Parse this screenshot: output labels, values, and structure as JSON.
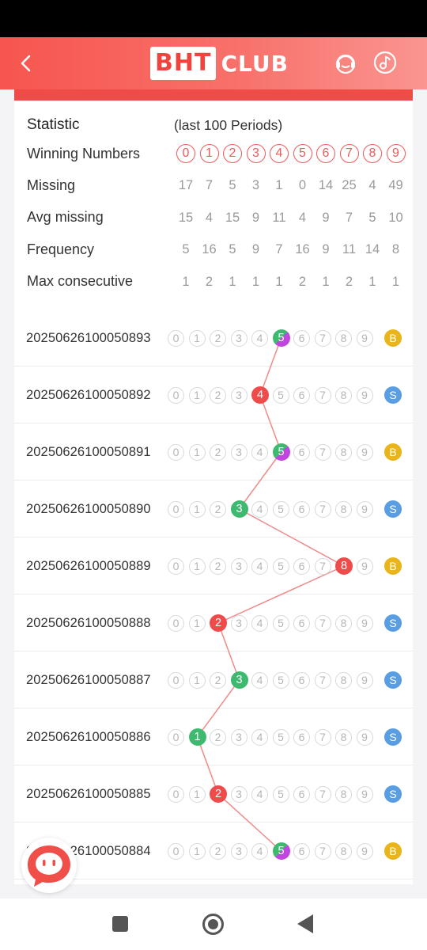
{
  "header": {
    "logo_box": "BHT",
    "logo_text": "CLUB",
    "icons": {
      "back": "back-arrow-icon",
      "support": "customer-service-icon",
      "music": "music-note-icon"
    }
  },
  "stats": {
    "title_label": "Statistic",
    "period_label": "(last 100 Periods)",
    "winning_numbers_label": "Winning Numbers",
    "winning_numbers": [
      "0",
      "1",
      "2",
      "3",
      "4",
      "5",
      "6",
      "7",
      "8",
      "9"
    ],
    "rows": [
      {
        "label": "Missing",
        "values": [
          "17",
          "7",
          "5",
          "3",
          "1",
          "0",
          "14",
          "25",
          "4",
          "49"
        ]
      },
      {
        "label": "Avg missing",
        "values": [
          "15",
          "4",
          "15",
          "9",
          "11",
          "4",
          "9",
          "7",
          "5",
          "10"
        ]
      },
      {
        "label": "Frequency",
        "values": [
          "5",
          "16",
          "5",
          "9",
          "7",
          "16",
          "9",
          "11",
          "14",
          "8"
        ]
      },
      {
        "label": "Max consecutive",
        "values": [
          "1",
          "2",
          "1",
          "1",
          "1",
          "2",
          "1",
          "2",
          "1",
          "1"
        ]
      }
    ]
  },
  "digits": [
    "0",
    "1",
    "2",
    "3",
    "4",
    "5",
    "6",
    "7",
    "8",
    "9"
  ],
  "history": [
    {
      "issue": "20250626100050893",
      "number": 5,
      "size": "B"
    },
    {
      "issue": "20250626100050892",
      "number": 4,
      "size": "S"
    },
    {
      "issue": "20250626100050891",
      "number": 5,
      "size": "B"
    },
    {
      "issue": "20250626100050890",
      "number": 3,
      "size": "S"
    },
    {
      "issue": "20250626100050889",
      "number": 8,
      "size": "B"
    },
    {
      "issue": "20250626100050888",
      "number": 2,
      "size": "S"
    },
    {
      "issue": "20250626100050887",
      "number": 3,
      "size": "S"
    },
    {
      "issue": "20250626100050886",
      "number": 1,
      "size": "S"
    },
    {
      "issue": "20250626100050885",
      "number": 2,
      "size": "S"
    },
    {
      "issue": "20250626100050884",
      "number": 5,
      "size": "B"
    }
  ],
  "colors": {
    "header_start": "#f7554f",
    "header_end": "#fa9590",
    "red": "#ef4b4b",
    "green": "#3dba6f",
    "violet": "#c345e0",
    "big": "#eab51a",
    "small": "#5a9de3",
    "trend_line": "#f08a88"
  },
  "chat_fab_icon": "chat-bubble-icon",
  "nav": {
    "square": "recent-apps-icon",
    "home": "home-icon",
    "back": "nav-back-icon"
  }
}
